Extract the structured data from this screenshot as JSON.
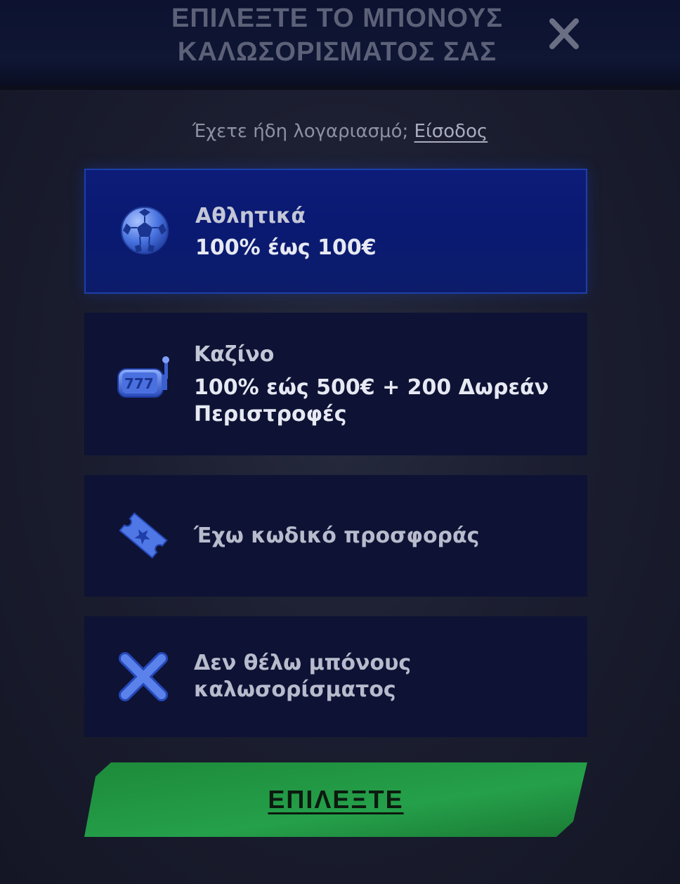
{
  "header": {
    "title_line1": "ΕΠΙΛΕΞΤΕ ΤΟ ΜΠΟΝΟΥΣ",
    "title_line2": "ΚΑΛΩΣΟΡΙΣΜΑΤΟΣ ΣΑΣ",
    "close_icon": "close-icon"
  },
  "login": {
    "prompt": "Έχετε ήδη λογαριασμό;",
    "link_label": "Είσοδος"
  },
  "options": [
    {
      "title": "Αθλητικά",
      "detail": "100% έως 100€",
      "icon": "soccer-ball-icon",
      "selected": true
    },
    {
      "title": "Καζίνο",
      "detail": "100% εώς 500€ + 200 Δωρεάν Περιστροφές",
      "icon": "slot-machine-icon",
      "selected": false
    },
    {
      "label": "Έχω κωδικό προσφοράς",
      "icon": "promo-ticket-icon",
      "selected": false
    },
    {
      "label": "Δεν θέλω μπόνους καλωσορίσματος",
      "icon": "no-bonus-x-icon",
      "selected": false
    }
  ],
  "cta": {
    "label": "ΕΠΙΛΕΞΤΕ"
  },
  "colors": {
    "selected_card": "#0c1c78",
    "card": "#0e1234",
    "cta_green": "#1f8a3c",
    "icon_blue": "#3a66d8"
  }
}
